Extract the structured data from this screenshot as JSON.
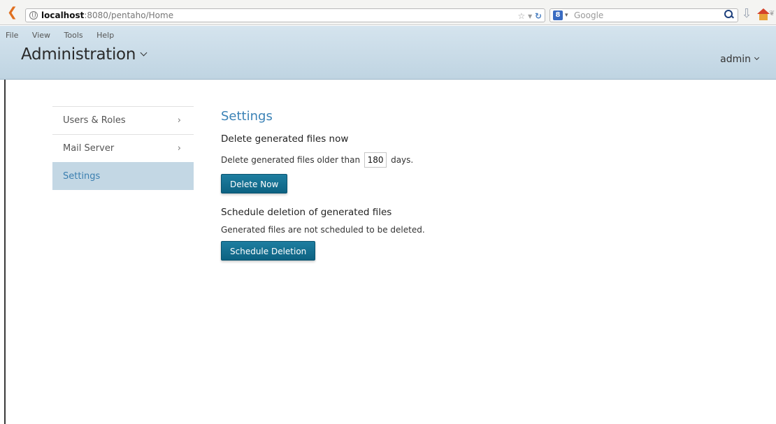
{
  "browser": {
    "url_host": "localhost",
    "url_rest": ":8080/pentaho/Home",
    "search_placeholder": "Google",
    "search_engine_label": "8"
  },
  "app": {
    "menu": [
      "File",
      "View",
      "Tools",
      "Help"
    ],
    "perspective": "Administration",
    "user": "admin"
  },
  "sidebar": {
    "items": [
      {
        "label": "Users & Roles",
        "arrow": "›"
      },
      {
        "label": "Mail Server",
        "arrow": "›"
      },
      {
        "label": "Settings"
      }
    ]
  },
  "main": {
    "title": "Settings",
    "delete_section": {
      "heading": "Delete generated files now",
      "prefix": "Delete generated files older than",
      "days_value": "180",
      "suffix": "days.",
      "button": "Delete Now"
    },
    "schedule_section": {
      "heading": "Schedule deletion of generated files",
      "status": "Generated files are not scheduled to be deleted.",
      "button": "Schedule Deletion"
    }
  },
  "colors": {
    "accent": "#3b82b6",
    "button": "#0d6282",
    "header_bg": "#c9dbe7",
    "sidebar_active": "#c3d7e4"
  }
}
